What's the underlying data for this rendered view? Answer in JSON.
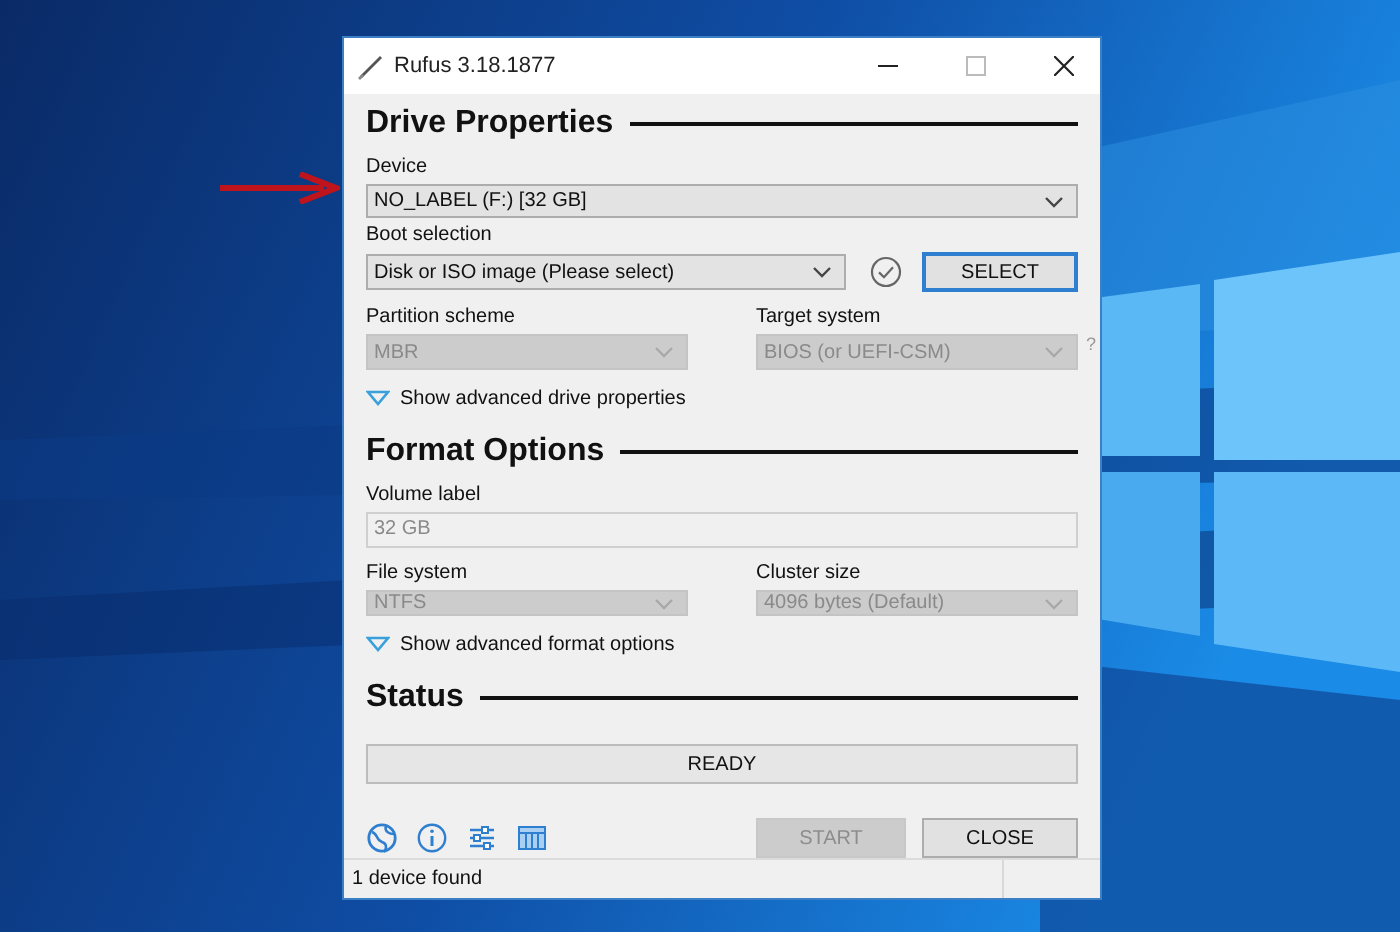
{
  "window": {
    "title": "Rufus 3.18.1877"
  },
  "drive_properties": {
    "heading": "Drive Properties",
    "device": {
      "label": "Device",
      "value": "NO_LABEL (F:) [32 GB]",
      "disabled": false
    },
    "boot_selection": {
      "label": "Boot selection",
      "value": "Disk or ISO image (Please select)",
      "disabled": false
    },
    "select_button": "SELECT",
    "partition_scheme": {
      "label": "Partition scheme",
      "value": "MBR",
      "disabled": true
    },
    "target_system": {
      "label": "Target system",
      "value": "BIOS (or UEFI-CSM)",
      "disabled": true,
      "help": "?"
    },
    "advanced": {
      "label": "Show advanced drive properties",
      "expanded": false
    }
  },
  "format_options": {
    "heading": "Format Options",
    "volume_label": {
      "label": "Volume label",
      "value": "32 GB",
      "disabled": true
    },
    "file_system": {
      "label": "File system",
      "value": "NTFS",
      "disabled": true
    },
    "cluster_size": {
      "label": "Cluster size",
      "value": "4096 bytes (Default)",
      "disabled": true
    },
    "advanced": {
      "label": "Show advanced format options",
      "expanded": false
    }
  },
  "status": {
    "heading": "Status",
    "progress": {
      "text": "READY"
    }
  },
  "buttons": [
    {
      "label": "START",
      "disabled": true
    },
    {
      "label": "CLOSE",
      "disabled": false
    }
  ],
  "status_bar": "1 device found"
}
